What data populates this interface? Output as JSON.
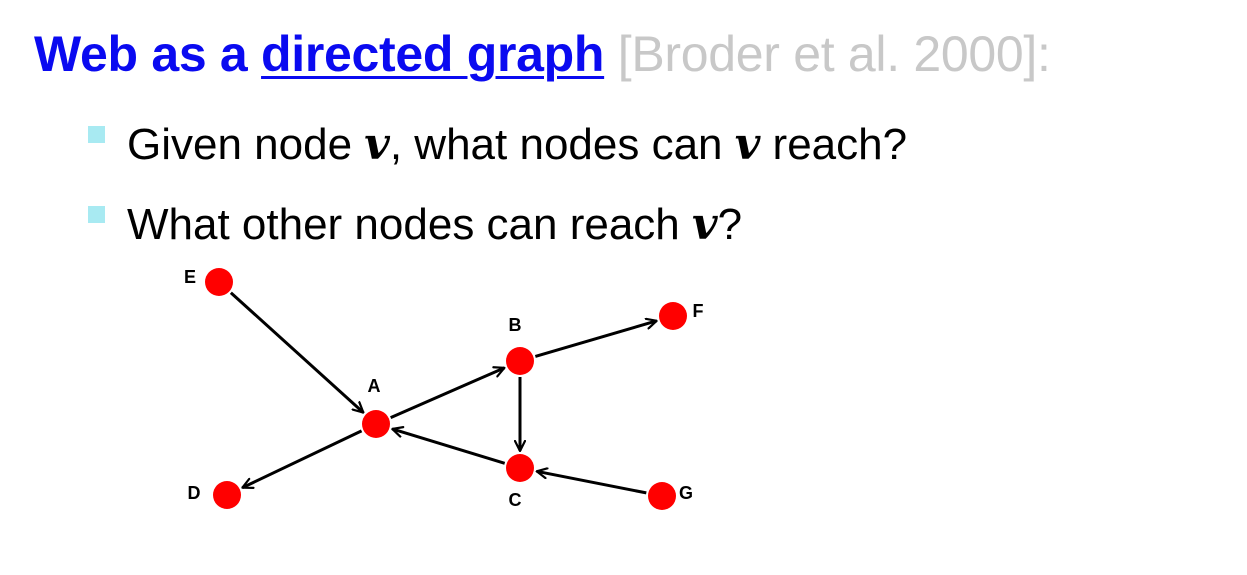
{
  "slide": {
    "title": {
      "main": "Web as a ",
      "link": "directed graph",
      "citation": " [Broder et al. 2000]:"
    },
    "bullets": [
      {
        "pre": "Given node ",
        "var1": "v",
        "mid": ", what nodes can ",
        "var2": "v",
        "post": " reach?"
      },
      {
        "pre": "What other nodes can reach ",
        "var1": "v",
        "post": "?"
      }
    ]
  },
  "graph": {
    "node_color": "#ff0000",
    "edge_color": "#000000",
    "nodes": [
      {
        "id": "A",
        "label": "A"
      },
      {
        "id": "B",
        "label": "B"
      },
      {
        "id": "C",
        "label": "C"
      },
      {
        "id": "D",
        "label": "D"
      },
      {
        "id": "E",
        "label": "E"
      },
      {
        "id": "F",
        "label": "F"
      },
      {
        "id": "G",
        "label": "G"
      }
    ],
    "edges": [
      {
        "from": "E",
        "to": "A"
      },
      {
        "from": "A",
        "to": "B"
      },
      {
        "from": "B",
        "to": "F"
      },
      {
        "from": "B",
        "to": "C"
      },
      {
        "from": "C",
        "to": "A"
      },
      {
        "from": "A",
        "to": "D"
      },
      {
        "from": "G",
        "to": "C"
      }
    ]
  }
}
